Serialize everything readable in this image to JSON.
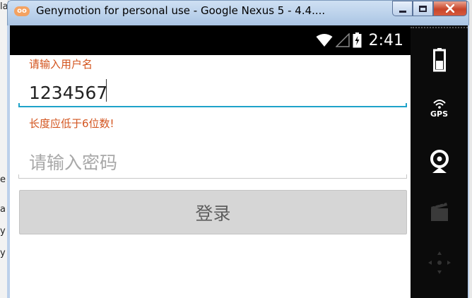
{
  "window": {
    "title": "Genymotion for personal use - Google Nexus 5 - 4.4....",
    "app_icon_text": "oo"
  },
  "background": {
    "fragments": [
      "la",
      "e",
      "a",
      "y",
      "y"
    ]
  },
  "status_bar": {
    "time": "2:41",
    "icons": [
      "wifi-icon",
      "signal-icon",
      "battery-icon"
    ]
  },
  "login_form": {
    "username_label": "请输入用户名",
    "username_value": "1234567",
    "username_error": "长度应低于6位数!",
    "password_placeholder": "请输入密码",
    "login_button": "登录"
  },
  "sidebar": {
    "gps_label": "GPS",
    "tools": [
      "battery-tool-icon",
      "gps-tool-icon",
      "camera-tool-icon",
      "clapperboard-tool-icon",
      "dpad-tool-icon"
    ]
  },
  "colors": {
    "accent": "#1ea2c9",
    "error": "#d3541e",
    "button_bg": "#d6d6d6"
  }
}
